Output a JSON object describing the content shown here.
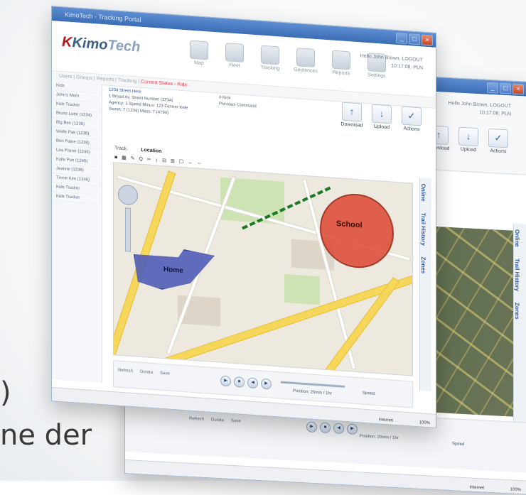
{
  "backdrop_text": {
    "line1": ")",
    "line2": "ne der"
  },
  "back_window": {
    "title": "",
    "actions": [
      "Download",
      "Upload",
      "Actions"
    ],
    "side_tabs": [
      "Online",
      "Trail History",
      "Zones"
    ],
    "user_line1": "Hello John Brown, LOGOUT",
    "user_line2": "10:17:08, PLN",
    "playback": {
      "buttons": [
        "Refresh",
        "Durata",
        "Save"
      ],
      "position": "Position: 20min / 1hr",
      "speed": "Speed"
    },
    "status": {
      "internet": "Internet",
      "zoom": "100%"
    }
  },
  "front_window": {
    "title": "KimoTech - Tracking Portal",
    "logo": {
      "main": "Kimo",
      "accent": "Tech",
      "prefix": "K"
    },
    "toolbar_icons": [
      "Map",
      "Fleet",
      "Tracking",
      "Geofences",
      "Reports",
      "Settings"
    ],
    "user_line1": "Hello John Brown, LOGOUT",
    "user_line2": "10:17:08, PLN",
    "nav": [
      "Users",
      "Groups",
      "Reports",
      "Tracking"
    ],
    "nav_active": "Current Status - Kids",
    "sidebar_items": [
      "Kids",
      "John's Mom",
      "Kids Tracker",
      "Bruno Lotte (1234)",
      "Big Ben (1236)",
      "Wolfe Pak (1238)",
      "Ben Paine (1238)",
      "Lea Pisner (1246)",
      "Kylla Pun (1246)",
      "Jeanne (1238)",
      "Tinnie Kim (1246)",
      "Kids Tracker",
      "Kids Tracker"
    ],
    "info": {
      "line1": "1234 Street Here",
      "line2": "1 Broad Av, Street Number (1234)",
      "line3": "Agency: 1 Speed  Minus: 123 Former Kele",
      "line4": "Sweet: 7 (1234)  Mass: 7 (4794)"
    },
    "info2": {
      "line1": "# Kick",
      "line2": "Previous Command"
    },
    "actions": [
      {
        "label": "Download",
        "glyph": "↑"
      },
      {
        "label": "Upload",
        "glyph": "↓"
      },
      {
        "label": "Actions",
        "glyph": "✓"
      }
    ],
    "map_tabs": [
      "Track",
      "Location"
    ],
    "map_tab_active": "Location",
    "map_tools": "■ ▦ ✎ Q ✂ ↕ ⊟ ⊞ ☐ ↔ ⇔",
    "zones": {
      "home": "Home",
      "school": "School"
    },
    "side_tabs": [
      "Online",
      "Trail History",
      "Zones"
    ],
    "playback": {
      "buttons": [
        "Refresh",
        "Durata",
        "Save"
      ],
      "position": "Position: 20min / 1hr",
      "speed": "Speed"
    },
    "status": {
      "internet": "Internet",
      "zoom": "100%"
    }
  },
  "colors": {
    "titlebar": "#3b6db5",
    "home_zone": "#5460b8",
    "school_zone": "#dc4632",
    "track": "#1c7a23",
    "road": "#f6d75a"
  }
}
